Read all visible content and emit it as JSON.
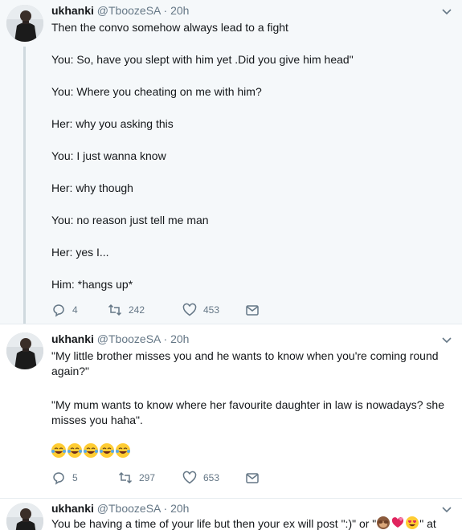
{
  "tweets": [
    {
      "name": "ukhanki",
      "handle": "@TboozeSA",
      "dot": "·",
      "time": "20h",
      "lines": [
        "Then the convo somehow always lead to a fight",
        "You: So, have you slept with him yet .Did you give him head\"",
        "You: Where you cheating on me with him?",
        "Her: why you asking this",
        "You: I just wanna know",
        "Her: why though",
        "You: no reason just tell me man",
        "Her: yes I...",
        "Him: *hangs up*"
      ],
      "replies": "4",
      "retweets": "242",
      "likes": "453"
    },
    {
      "name": "ukhanki",
      "handle": "@TboozeSA",
      "dot": "·",
      "time": "20h",
      "lines": [
        "\"My little brother misses you and he wants to know when you're coming round",
        "again?\"",
        " \"My mum wants to know where her favourite daughter in law is nowadays? she",
        "misses you haha\"."
      ],
      "emoji_count": "😂😂😂😂😂",
      "replies": "5",
      "retweets": "297",
      "likes": "653"
    },
    {
      "name": "ukhanki",
      "handle": "@TboozeSA",
      "dot": "·",
      "time": "20h",
      "line_start": "You be having a time of your life but then your ex will post \":)\" or \"",
      "line_end": "\" at"
    }
  ],
  "colors": {
    "highlight_bg": "#f5f8fa",
    "text": "#14171a",
    "muted": "#657786",
    "thread": "#cfd9de"
  },
  "icons": [
    "reply-icon",
    "retweet-icon",
    "like-icon",
    "direct-message-icon",
    "caret-down-icon",
    "tears-of-joy-emoji",
    "see-no-evil-monkey-emoji",
    "two-hearts-emoji",
    "heart-eyes-emoji"
  ]
}
